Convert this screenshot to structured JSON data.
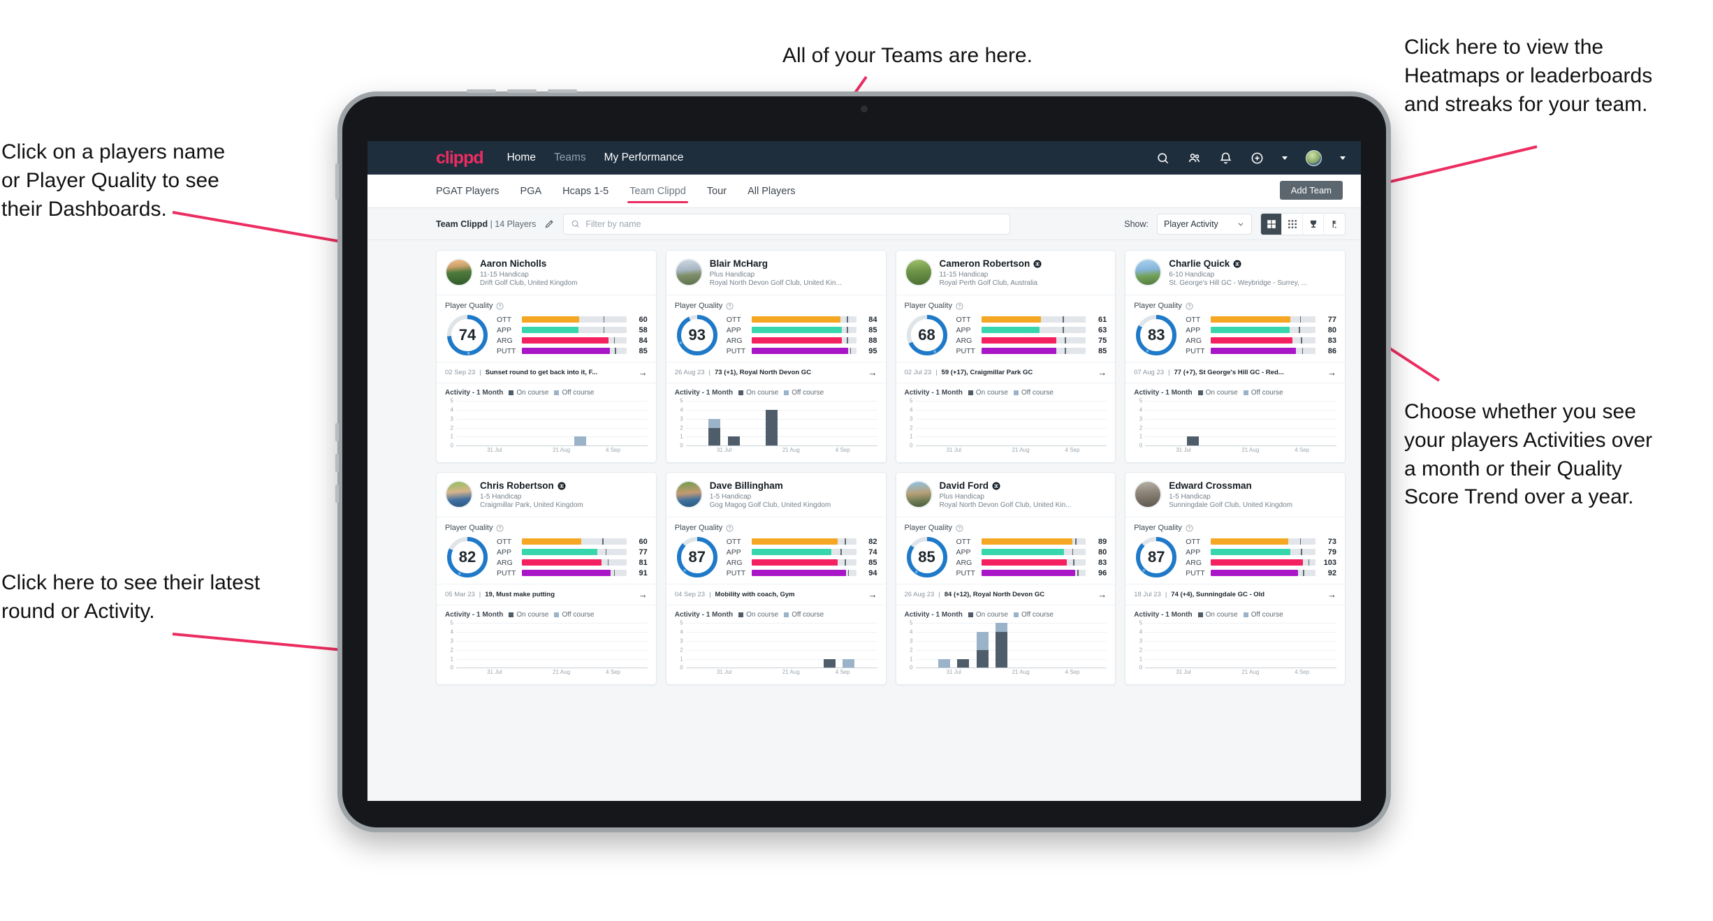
{
  "annotations": [
    {
      "id": "players-name",
      "text": "Click on a players name\nor Player Quality to see\ntheir Dashboards."
    },
    {
      "id": "teams-here",
      "text": "All of your Teams are here."
    },
    {
      "id": "heatmaps",
      "text": "Click here to view the\nHeatmaps or leaderboards\nand streaks for your team."
    },
    {
      "id": "latest-round",
      "text": "Click here to see their latest\nround or Activity."
    },
    {
      "id": "activity-or-quality",
      "text": "Choose whether you see\nyour players Activities over\na month or their Quality\nScore Trend over a year."
    }
  ],
  "app": {
    "logo": "clippd",
    "nav": [
      {
        "label": "Home",
        "active": true
      },
      {
        "label": "Teams",
        "active": false
      },
      {
        "label": "My Performance",
        "active": true
      }
    ],
    "top_icons": [
      "search-icon",
      "people-icon",
      "bell-icon",
      "plus-circle-icon",
      "avatar"
    ],
    "tabs": [
      {
        "label": "PGAT Players",
        "active": false
      },
      {
        "label": "PGA",
        "active": false
      },
      {
        "label": "Hcaps 1-5",
        "active": false
      },
      {
        "label": "Team Clippd",
        "active": true
      },
      {
        "label": "Tour",
        "active": false
      },
      {
        "label": "All Players",
        "active": false
      }
    ],
    "add_team_label": "Add Team",
    "filter": {
      "team_name": "Team Clippd",
      "team_count": "| 14 Players",
      "edit_icon": "pencil-icon",
      "search_placeholder": "Filter by name",
      "show_label": "Show:",
      "show_value": "Player Activity",
      "view_toggles": [
        {
          "icon": "grid-large-icon",
          "active": true
        },
        {
          "icon": "grid-dense-icon",
          "active": false
        },
        {
          "icon": "trophy-icon",
          "active": false
        },
        {
          "icon": "flag-icon",
          "active": false
        }
      ]
    }
  },
  "labels": {
    "player_quality": "Player Quality",
    "activity_title": "Activity - 1 Month",
    "legend_on": "On course",
    "legend_off": "Off course",
    "metric_keys": [
      "OTT",
      "APP",
      "ARG",
      "PUTT"
    ]
  },
  "colors": {
    "brand": "#ec2d61",
    "navbar": "#1e2e3d",
    "ring": "#1e79c8",
    "ott": "#f5a623",
    "app": "#37d6ac",
    "arg": "#f4205f",
    "putt": "#a816c8",
    "on_course": "#4e5d69",
    "off_course": "#9ab3c8",
    "annotation_arrow": "#ec2d61"
  },
  "chart_common": {
    "type": "bar",
    "ylim": [
      0,
      5
    ],
    "yticks": [
      0,
      1,
      2,
      3,
      4,
      5
    ],
    "xticks": [
      "31 Jul",
      "21 Aug",
      "4 Sep"
    ],
    "series": [
      "On course",
      "Off course"
    ],
    "grid": true
  },
  "players": [
    {
      "name": "Aaron Nicholls",
      "verified": false,
      "handicap": "11-15 Handicap",
      "club": "Drift Golf Club, United Kingdom",
      "quality": 74,
      "metrics": [
        {
          "key": "OTT",
          "value": 60,
          "fill": 55,
          "tick": 78
        },
        {
          "key": "APP",
          "value": 58,
          "fill": 54,
          "tick": 78
        },
        {
          "key": "ARG",
          "value": 84,
          "fill": 83,
          "tick": 88
        },
        {
          "key": "PUTT",
          "value": 85,
          "fill": 84,
          "tick": 89
        }
      ],
      "last_date": "02 Sep 23",
      "last_text": "Sunset round to get back into it, F...",
      "chart_data": {
        "type": "bar",
        "title": "Activity - 1 Month",
        "categories": [
          "31 Jul",
          "21 Aug",
          "4 Sep"
        ],
        "ylim": [
          0,
          5
        ],
        "bars": [
          {
            "slot": 6,
            "on": 0,
            "off": 1
          }
        ],
        "slots": 10
      }
    },
    {
      "name": "Blair McHarg",
      "verified": false,
      "handicap": "Plus Handicap",
      "club": "Royal North Devon Golf Club, United Kin...",
      "quality": 93,
      "metrics": [
        {
          "key": "OTT",
          "value": 84,
          "fill": 85,
          "tick": 91
        },
        {
          "key": "APP",
          "value": 85,
          "fill": 86,
          "tick": 91
        },
        {
          "key": "ARG",
          "value": 88,
          "fill": 86,
          "tick": 91
        },
        {
          "key": "PUTT",
          "value": 95,
          "fill": 92,
          "tick": 94
        }
      ],
      "last_date": "26 Aug 23",
      "last_text": "73 (+1), Royal North Devon GC",
      "chart_data": {
        "type": "bar",
        "title": "Activity - 1 Month",
        "categories": [
          "31 Jul",
          "21 Aug",
          "4 Sep"
        ],
        "ylim": [
          0,
          5
        ],
        "bars": [
          {
            "slot": 1,
            "on": 2,
            "off": 1
          },
          {
            "slot": 2,
            "on": 1,
            "off": 0
          },
          {
            "slot": 4,
            "on": 4,
            "off": 0
          }
        ],
        "slots": 10
      }
    },
    {
      "name": "Cameron Robertson",
      "verified": true,
      "handicap": "11-15 Handicap",
      "club": "Royal Perth Golf Club, Australia",
      "quality": 68,
      "metrics": [
        {
          "key": "OTT",
          "value": 61,
          "fill": 57,
          "tick": 78
        },
        {
          "key": "APP",
          "value": 63,
          "fill": 56,
          "tick": 78
        },
        {
          "key": "ARG",
          "value": 75,
          "fill": 72,
          "tick": 80
        },
        {
          "key": "PUTT",
          "value": 85,
          "fill": 72,
          "tick": 80
        }
      ],
      "last_date": "02 Jul 23",
      "last_text": "59 (+17), Craigmillar Park GC",
      "chart_data": {
        "type": "bar",
        "title": "Activity - 1 Month",
        "categories": [
          "31 Jul",
          "21 Aug",
          "4 Sep"
        ],
        "ylim": [
          0,
          5
        ],
        "bars": [],
        "slots": 10
      }
    },
    {
      "name": "Charlie Quick",
      "verified": true,
      "handicap": "6-10 Handicap",
      "club": "St. George's Hill GC - Weybridge - Surrey, ...",
      "quality": 83,
      "metrics": [
        {
          "key": "OTT",
          "value": 77,
          "fill": 76,
          "tick": 85
        },
        {
          "key": "APP",
          "value": 80,
          "fill": 75,
          "tick": 84
        },
        {
          "key": "ARG",
          "value": 83,
          "fill": 78,
          "tick": 86
        },
        {
          "key": "PUTT",
          "value": 86,
          "fill": 81,
          "tick": 87
        }
      ],
      "last_date": "07 Aug 23",
      "last_text": "77 (+7), St George's Hill GC - Red...",
      "chart_data": {
        "type": "bar",
        "title": "Activity - 1 Month",
        "categories": [
          "31 Jul",
          "21 Aug",
          "4 Sep"
        ],
        "ylim": [
          0,
          5
        ],
        "bars": [
          {
            "slot": 2,
            "on": 1,
            "off": 0
          }
        ],
        "slots": 10
      }
    },
    {
      "name": "Chris Robertson",
      "verified": true,
      "handicap": "1-5 Handicap",
      "club": "Craigmillar Park, United Kingdom",
      "quality": 82,
      "metrics": [
        {
          "key": "OTT",
          "value": 60,
          "fill": 57,
          "tick": 77
        },
        {
          "key": "APP",
          "value": 77,
          "fill": 72,
          "tick": 80
        },
        {
          "key": "ARG",
          "value": 81,
          "fill": 76,
          "tick": 82
        },
        {
          "key": "PUTT",
          "value": 91,
          "fill": 85,
          "tick": 88
        }
      ],
      "last_date": "05 Mar 23",
      "last_text": "19, Must make putting",
      "chart_data": {
        "type": "bar",
        "title": "Activity - 1 Month",
        "categories": [
          "31 Jul",
          "21 Aug",
          "4 Sep"
        ],
        "ylim": [
          0,
          5
        ],
        "bars": [],
        "slots": 10
      }
    },
    {
      "name": "Dave Billingham",
      "verified": false,
      "handicap": "1-5 Handicap",
      "club": "Gog Magog Golf Club, United Kingdom",
      "quality": 87,
      "metrics": [
        {
          "key": "OTT",
          "value": 82,
          "fill": 82,
          "tick": 89
        },
        {
          "key": "APP",
          "value": 74,
          "fill": 76,
          "tick": 85
        },
        {
          "key": "ARG",
          "value": 85,
          "fill": 82,
          "tick": 89
        },
        {
          "key": "PUTT",
          "value": 94,
          "fill": 90,
          "tick": 92
        }
      ],
      "last_date": "04 Sep 23",
      "last_text": "Mobility with coach, Gym",
      "chart_data": {
        "type": "bar",
        "title": "Activity - 1 Month",
        "categories": [
          "31 Jul",
          "21 Aug",
          "4 Sep"
        ],
        "ylim": [
          0,
          5
        ],
        "bars": [
          {
            "slot": 7,
            "on": 1,
            "off": 0
          },
          {
            "slot": 8,
            "on": 0,
            "off": 1
          }
        ],
        "slots": 10
      }
    },
    {
      "name": "David Ford",
      "verified": true,
      "handicap": "Plus Handicap",
      "club": "Royal North Devon Golf Club, United Kin...",
      "quality": 85,
      "metrics": [
        {
          "key": "OTT",
          "value": 89,
          "fill": 87,
          "tick": 90
        },
        {
          "key": "APP",
          "value": 80,
          "fill": 79,
          "tick": 87
        },
        {
          "key": "ARG",
          "value": 83,
          "fill": 82,
          "tick": 88
        },
        {
          "key": "PUTT",
          "value": 96,
          "fill": 90,
          "tick": 92
        }
      ],
      "last_date": "26 Aug 23",
      "last_text": "84 (+12), Royal North Devon GC",
      "chart_data": {
        "type": "bar",
        "title": "Activity - 1 Month",
        "categories": [
          "31 Jul",
          "21 Aug",
          "4 Sep"
        ],
        "ylim": [
          0,
          5
        ],
        "bars": [
          {
            "slot": 1,
            "on": 0,
            "off": 1
          },
          {
            "slot": 2,
            "on": 1,
            "off": 0
          },
          {
            "slot": 3,
            "on": 2,
            "off": 2
          },
          {
            "slot": 4,
            "on": 4,
            "off": 1
          }
        ],
        "slots": 10
      }
    },
    {
      "name": "Edward Crossman",
      "verified": false,
      "handicap": "1-5 Handicap",
      "club": "Sunningdale Golf Club, United Kingdom",
      "quality": 87,
      "metrics": [
        {
          "key": "OTT",
          "value": 73,
          "fill": 74,
          "tick": 85
        },
        {
          "key": "APP",
          "value": 79,
          "fill": 76,
          "tick": 86
        },
        {
          "key": "ARG",
          "value": 103,
          "fill": 88,
          "tick": 93
        },
        {
          "key": "PUTT",
          "value": 92,
          "fill": 83,
          "tick": 88
        }
      ],
      "last_date": "18 Jul 23",
      "last_text": "74 (+4), Sunningdale GC - Old",
      "chart_data": {
        "type": "bar",
        "title": "Activity - 1 Month",
        "categories": [
          "31 Jul",
          "21 Aug",
          "4 Sep"
        ],
        "ylim": [
          0,
          5
        ],
        "bars": [],
        "slots": 10
      }
    }
  ]
}
